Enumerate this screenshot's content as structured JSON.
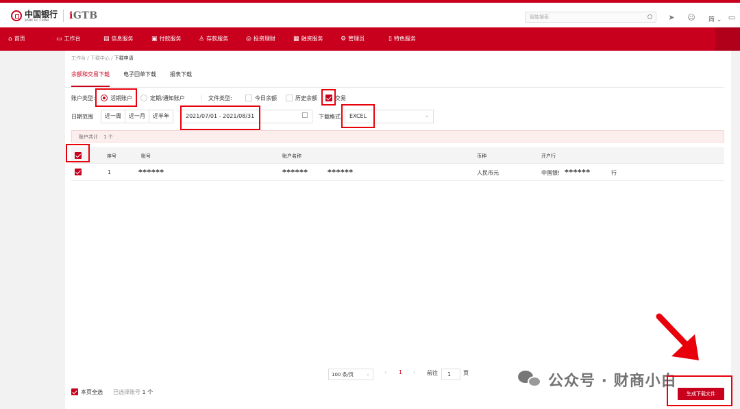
{
  "brand": {
    "logo_cn": "中国银行",
    "logo_en": "BANK OF CHINA",
    "product": "GTB"
  },
  "topbar": {
    "search_placeholder": "智能搜索",
    "lang_label": "简"
  },
  "nav": {
    "items": [
      {
        "label": "首页",
        "icon": "home-icon"
      },
      {
        "label": "工作台",
        "icon": "monitor-icon"
      },
      {
        "label": "信息服务",
        "icon": "info-icon"
      },
      {
        "label": "付款服务",
        "icon": "payment-icon"
      },
      {
        "label": "存款服务",
        "icon": "deposit-icon"
      },
      {
        "label": "投资理财",
        "icon": "invest-icon"
      },
      {
        "label": "融资服务",
        "icon": "finance-icon"
      },
      {
        "label": "管理员",
        "icon": "gear-icon"
      },
      {
        "label": "特色服务",
        "icon": "feature-icon"
      }
    ]
  },
  "breadcrumb": {
    "items": [
      "工作台",
      "下载中心",
      "下载申请"
    ],
    "separator": "/"
  },
  "tabs": [
    {
      "label": "余额和交易下载",
      "active": true
    },
    {
      "label": "电子回单下载",
      "active": false
    },
    {
      "label": "报表下载",
      "active": false
    }
  ],
  "filters": {
    "account_type_label": "账户类型:",
    "account_type_options": [
      {
        "label": "活期账户",
        "selected": true
      },
      {
        "label": "定期/通知账户",
        "selected": false
      }
    ],
    "file_type_label": "文件类型:",
    "file_type_options": [
      {
        "label": "今日余额",
        "checked": false
      },
      {
        "label": "历史余额",
        "checked": false
      },
      {
        "label": "交易",
        "checked": true
      }
    ],
    "date_range_label": "日期范围",
    "date_presets": [
      "近一周",
      "近一月",
      "近半年"
    ],
    "date_range_value": "2021/07/01 - 2021/08/31",
    "download_format_label": "下载格式",
    "download_format_value": "EXCEL"
  },
  "summary": {
    "label": "账户共计",
    "count": "1 个"
  },
  "table": {
    "headers": [
      "序号",
      "账号",
      "账户名称",
      "币种",
      "开户行"
    ],
    "rows": [
      {
        "checked": true,
        "index": "1",
        "account_no": "******",
        "account_name_1": "******",
        "account_name_2": "******",
        "currency": "人民币元",
        "bank_prefix": "中国银!",
        "bank_mask": "******",
        "bank_suffix": "行"
      }
    ]
  },
  "pagination": {
    "page_size": "100 条/页",
    "current_page": "1",
    "goto_label": "前往",
    "goto_value": "1",
    "page_unit": "页"
  },
  "footer": {
    "select_all_label": "本页全选",
    "selected_label": "已选择账号",
    "selected_count": "1 个",
    "generate_button": "生成下载文件"
  },
  "watermark": {
    "text": "公众号 · 财商小白"
  },
  "colors": {
    "brand_red": "#c8001e",
    "annotation_red": "#e8000b"
  }
}
